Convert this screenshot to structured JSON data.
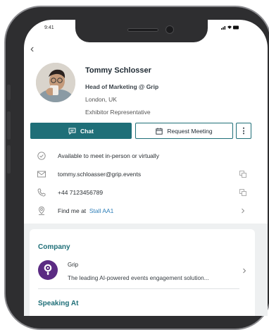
{
  "status_bar": {
    "time": "9:41",
    "icons": "..ıl ᯤ ▬"
  },
  "nav": {
    "back_label": "‹"
  },
  "profile": {
    "name": "Tommy Schlosser",
    "title": "Head of Marketing @ Grip",
    "location": "London, UK",
    "role": "Exhibitor Representative"
  },
  "actions": {
    "chat_label": "Chat",
    "request_meeting_label": "Request Meeting",
    "more_label": "⋮"
  },
  "details": {
    "availability": "Available to meet in-person or virtually",
    "email": "tommy.schloasser@grip.events",
    "phone": "+44 7123456789",
    "find_me_prefix": "Find me at",
    "find_me_location": "Stall AA1"
  },
  "company": {
    "heading": "Company",
    "name": "Grip",
    "description": "The leading AI-powered events engagement solution..."
  },
  "speaking": {
    "heading": "Speaking At"
  },
  "colors": {
    "accent": "#1f6f78",
    "link": "#2f7fb8",
    "logo": "#5b2b83"
  }
}
